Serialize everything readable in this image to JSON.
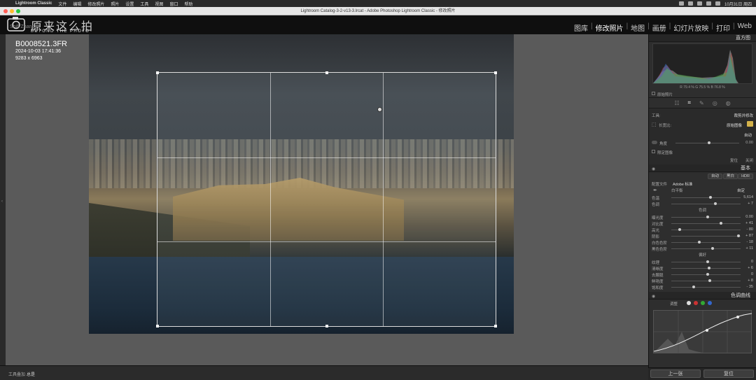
{
  "menubar": {
    "items": [
      "Lightroom Classic",
      "文件",
      "编辑",
      "修改照片",
      "照片",
      "设置",
      "工具",
      "视图",
      "窗口",
      "帮助"
    ],
    "clock": "10月31日 周四"
  },
  "window": {
    "title": "Lightroom Catalog-3-2-v13-3.lrcat - Adobe Photoshop Lightroom Classic - 修改照片"
  },
  "identity": {
    "name": "原来这么拍",
    "subtitle": "BEYOND THE PHOTO",
    "owner": "Shifl Zhang"
  },
  "modules": [
    "图库",
    "修改照片",
    "地图",
    "画册",
    "幻灯片放映",
    "打印",
    "Web"
  ],
  "active_module": "修改照片",
  "photo_info": {
    "filename": "B0008521.3FR",
    "datetime": "2024-10-03 17:41:36",
    "dimensions": "9283 x 6963"
  },
  "left_panel_toggle": "‹",
  "toolbar": {
    "tool_overlay": "工具叠加",
    "overlay_value": "总是"
  },
  "right_panel": {
    "histogram_title": "直方图",
    "histogram_readout": "R 79.4  %  G 75.5  %  B 76.8  %",
    "original_photo_label": "原始照片",
    "tool_section": {
      "tool_label": "工具:",
      "tool_value": "裁剪并修改",
      "aspect_label": "长宽比:",
      "aspect_value": "原始图像",
      "auto_label": "自动",
      "angle_label": "角度",
      "angle_value": "0.00",
      "constrain_label": "限定图像",
      "reset_label": "复位",
      "close_label": "关闭"
    },
    "basic": {
      "title": "基本",
      "auto_btn": "自动",
      "bw_btn": "黑白",
      "hdr_btn": "HDR",
      "profile_label": "配置文件",
      "profile_value": "Adobe 标准",
      "wb_label": "白平衡",
      "wb_value": "自定",
      "sliders_wb": [
        {
          "label": "色温",
          "value": "5,614"
        },
        {
          "label": "色调",
          "value": "+ 7"
        }
      ],
      "tone_title": "色调",
      "sliders_tone": [
        {
          "label": "曝光度",
          "value": "0.00"
        },
        {
          "label": "对比度",
          "value": "+ 41"
        },
        {
          "label": "高光",
          "value": "- 80"
        },
        {
          "label": "阴影",
          "value": "+ 87"
        },
        {
          "label": "白色色阶",
          "value": "- 18"
        },
        {
          "label": "黑色色阶",
          "value": "+ 11"
        }
      ],
      "presence_title": "偏好",
      "sliders_presence": [
        {
          "label": "纹理",
          "value": "0"
        },
        {
          "label": "清晰度",
          "value": "+ 6"
        },
        {
          "label": "去朦胧",
          "value": "0"
        },
        {
          "label": "鲜艳度",
          "value": "+ 8"
        },
        {
          "label": "饱和度",
          "value": "- 35"
        }
      ]
    },
    "curve": {
      "title": "色调曲线",
      "adjust_label": "调整"
    },
    "prev_btn": "上一张",
    "reset_btn": "复位"
  },
  "colors": {
    "accent": "#4a7fd0",
    "panel": "#2e2e2e",
    "center": "#5a5a5a"
  }
}
